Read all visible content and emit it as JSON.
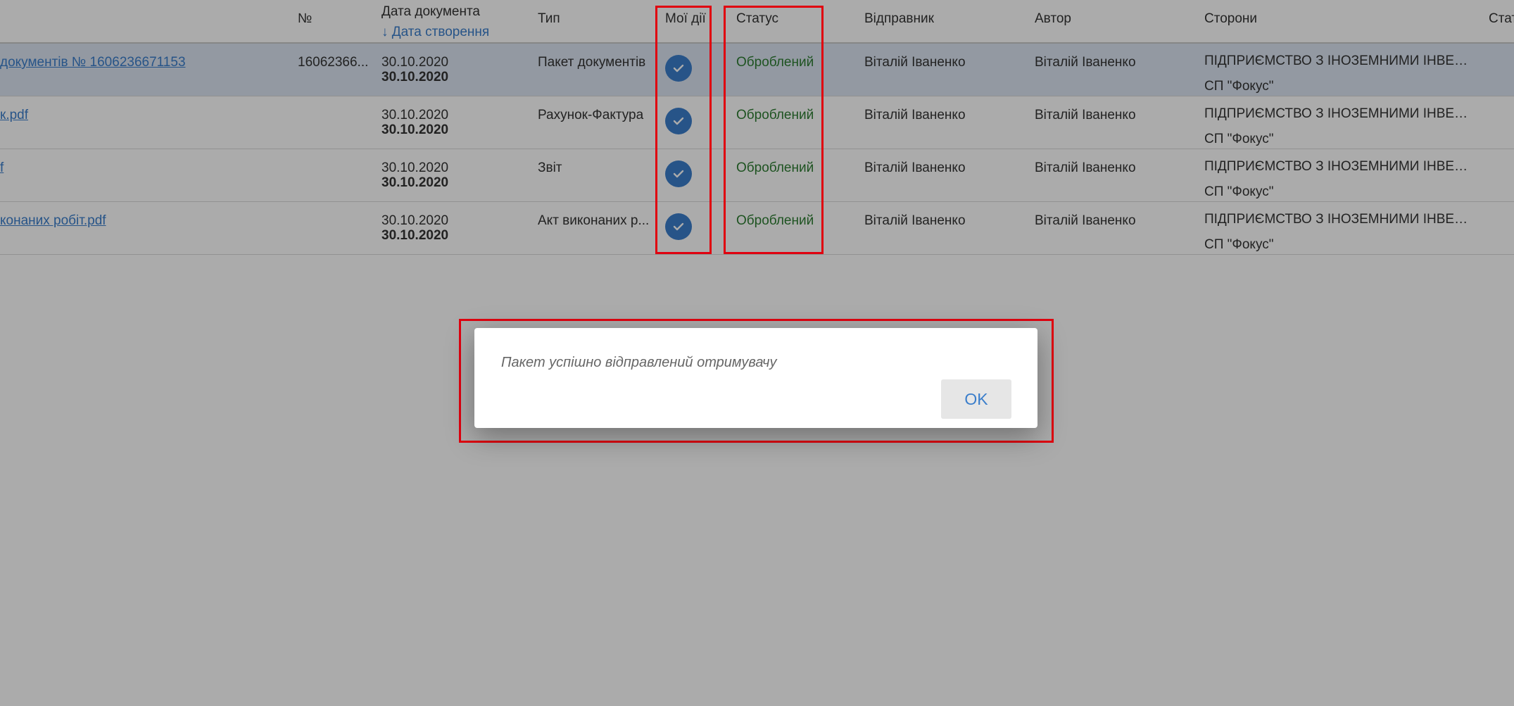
{
  "header": {
    "col_number": "№",
    "col_doc_date": "Дата документа",
    "col_created_date": "↓ Дата створення",
    "col_type": "Тип",
    "col_my_actions": "Мої дії",
    "col_status": "Статус",
    "col_sender": "Відправник",
    "col_author": "Автор",
    "col_parties": "Сторони",
    "col_more": "Стат"
  },
  "rows": [
    {
      "name": "документів № 1606236671153",
      "number": "16062366...",
      "doc_date": "30.10.2020",
      "created_date": "30.10.2020",
      "type": "Пакет документів",
      "status": "Оброблений",
      "sender": "Віталій Іваненко",
      "author": "Віталій Іваненко",
      "party_1": "ПІДПРИЄМСТВО З ІНОЗЕМНИМИ ІНВЕС...",
      "party_2": "СП \"Фокус\""
    },
    {
      "name": "к.pdf",
      "number": "",
      "doc_date": "30.10.2020",
      "created_date": "30.10.2020",
      "type": "Рахунок-Фактура",
      "status": "Оброблений",
      "sender": "Віталій Іваненко",
      "author": "Віталій Іваненко",
      "party_1": "ПІДПРИЄМСТВО З ІНОЗЕМНИМИ ІНВЕС...",
      "party_2": "СП \"Фокус\""
    },
    {
      "name": "f",
      "number": "",
      "doc_date": "30.10.2020",
      "created_date": "30.10.2020",
      "type": "Звіт",
      "status": "Оброблений",
      "sender": "Віталій Іваненко",
      "author": "Віталій Іваненко",
      "party_1": "ПІДПРИЄМСТВО З ІНОЗЕМНИМИ ІНВЕС...",
      "party_2": "СП \"Фокус\""
    },
    {
      "name": "конаних робіт.pdf",
      "number": "",
      "doc_date": "30.10.2020",
      "created_date": "30.10.2020",
      "type": "Акт виконаних р...",
      "status": "Оброблений",
      "sender": "Віталій Іваненко",
      "author": "Віталій Іваненко",
      "party_1": "ПІДПРИЄМСТВО З ІНОЗЕМНИМИ ІНВЕС...",
      "party_2": "СП \"Фокус\""
    }
  ],
  "dialog": {
    "message": "Пакет успішно відправлений отримувачу",
    "ok_label": "OK"
  },
  "icons": {
    "action_done": "check-circle-icon"
  },
  "colors": {
    "accent": "#3b7ecb",
    "status_ok": "#2e7d32",
    "highlight": "#e0000f",
    "selected_row": "#dbe5f2"
  }
}
